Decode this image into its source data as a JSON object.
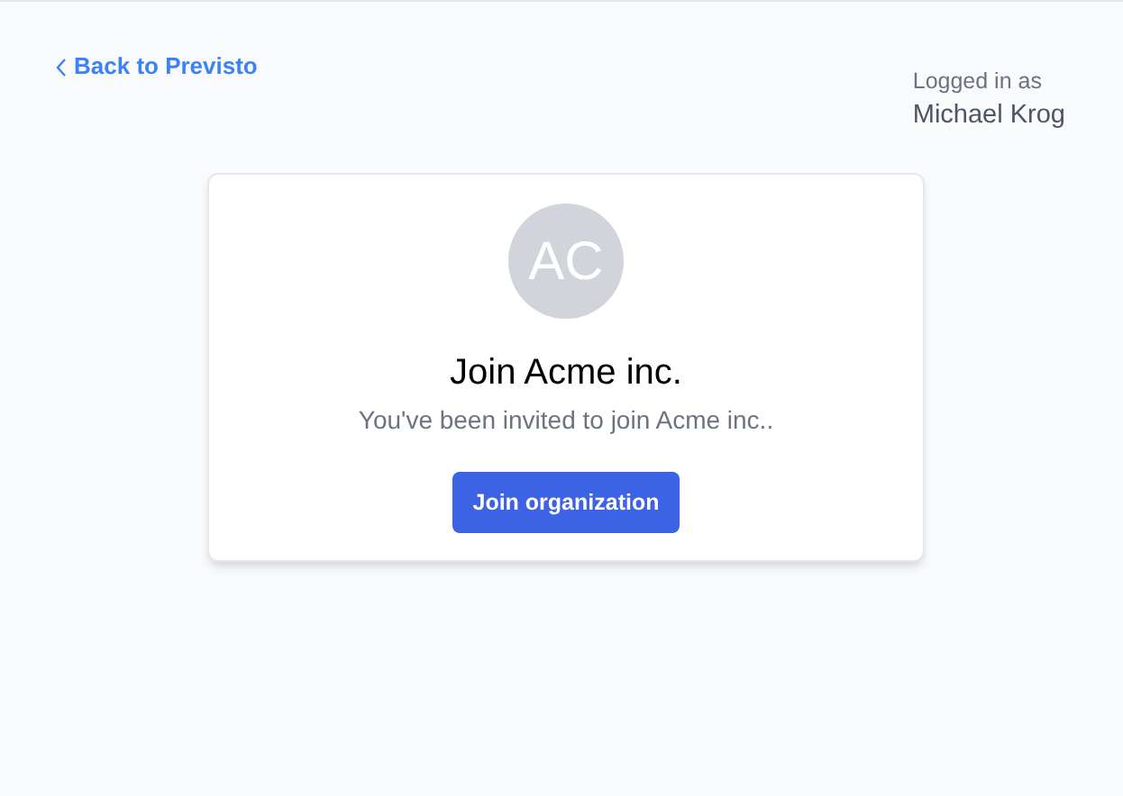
{
  "back_link": {
    "label": "Back to Previsto"
  },
  "user": {
    "caption": "Logged in as",
    "name": "Michael Krog"
  },
  "card": {
    "avatar": "AC",
    "title": "Join Acme inc.",
    "message": "You've been invited to join Acme inc..",
    "button": "Join organization"
  }
}
